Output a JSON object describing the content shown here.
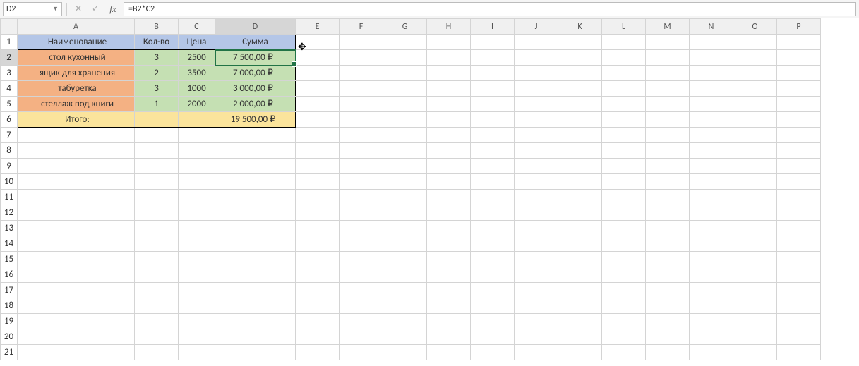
{
  "formula_bar": {
    "namebox": "D2",
    "formula": "=B2*C2"
  },
  "columns": [
    "A",
    "B",
    "C",
    "D",
    "E",
    "F",
    "G",
    "H",
    "I",
    "J",
    "K",
    "L",
    "M",
    "N",
    "O",
    "P"
  ],
  "row_numbers": [
    1,
    2,
    3,
    4,
    5,
    6,
    7,
    8,
    9,
    10,
    11,
    12,
    13,
    14,
    15,
    16,
    17,
    18,
    19,
    20,
    21
  ],
  "headers": {
    "name": "Наименование",
    "qty": "Кол-во",
    "price": "Цена",
    "sum": "Сумма"
  },
  "rows": [
    {
      "name": "стол кухонный",
      "qty": "3",
      "price": "2500",
      "sum": "7 500,00 ₽"
    },
    {
      "name": "ящик для хранения",
      "qty": "2",
      "price": "3500",
      "sum": "7 000,00 ₽"
    },
    {
      "name": "табуретка",
      "qty": "3",
      "price": "1000",
      "sum": "3 000,00 ₽"
    },
    {
      "name": "стеллаж под книги",
      "qty": "1",
      "price": "2000",
      "sum": "2 000,00 ₽"
    }
  ],
  "total": {
    "label": "Итого:",
    "sum": "19 500,00 ₽"
  },
  "selected_cell": "D2"
}
